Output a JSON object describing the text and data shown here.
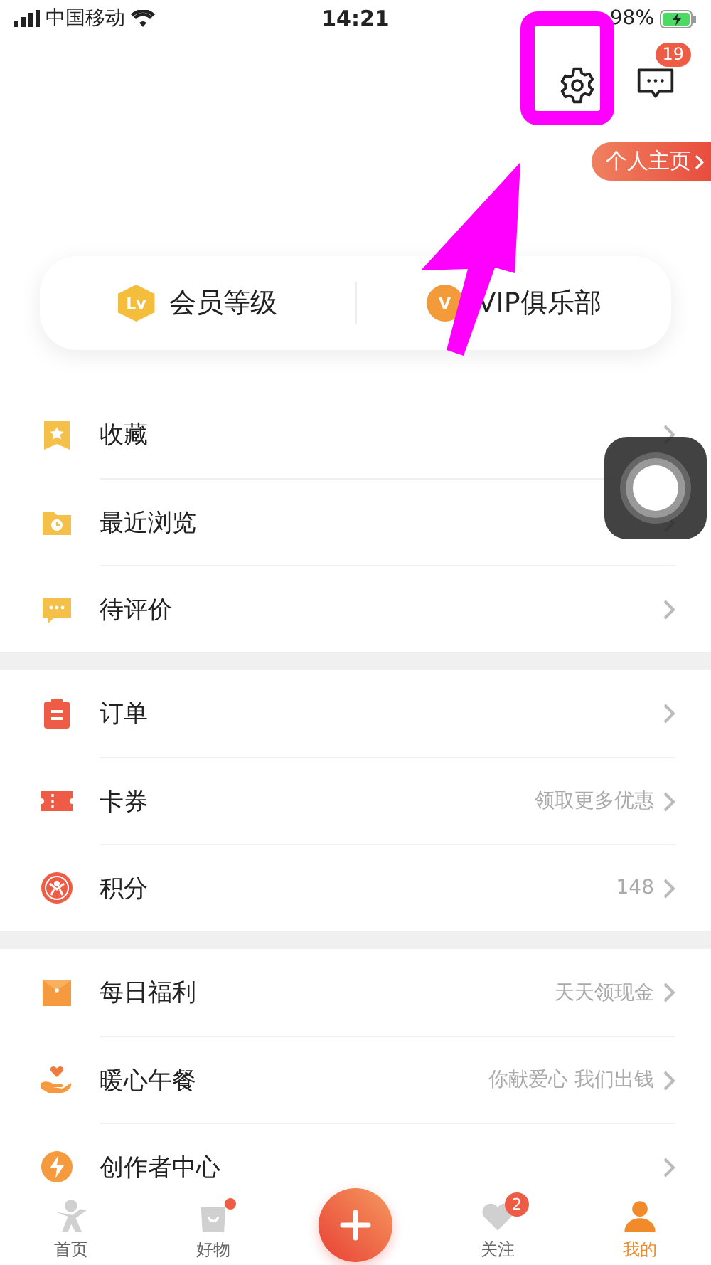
{
  "status_bar": {
    "carrier": "中国移动",
    "time": "14:21",
    "battery": "98%"
  },
  "header": {
    "message_badge": "19",
    "profile_link": "个人主页"
  },
  "membership": [
    {
      "badge": "Lv",
      "label": "会员等级"
    },
    {
      "badge": "V",
      "label": "VIP俱乐部"
    }
  ],
  "sections": [
    {
      "items": [
        {
          "label": "收藏"
        },
        {
          "label": "最近浏览"
        },
        {
          "label": "待评价"
        }
      ]
    },
    {
      "items": [
        {
          "label": "订单"
        },
        {
          "label": "卡券",
          "hint": "领取更多优惠"
        },
        {
          "label": "积分",
          "hint": "148"
        }
      ]
    },
    {
      "items": [
        {
          "label": "每日福利",
          "hint": "天天领现金"
        },
        {
          "label": "暖心午餐",
          "hint": "你献爱心 我们出钱"
        },
        {
          "label": "创作者中心"
        }
      ]
    }
  ],
  "tabs": [
    {
      "label": "首页",
      "selected": false,
      "dot": false
    },
    {
      "label": "好物",
      "selected": false,
      "dot": true
    },
    {
      "label": "关注",
      "selected": false,
      "dot": false,
      "badge": "2"
    },
    {
      "label": "我的",
      "selected": true,
      "dot": false
    }
  ]
}
